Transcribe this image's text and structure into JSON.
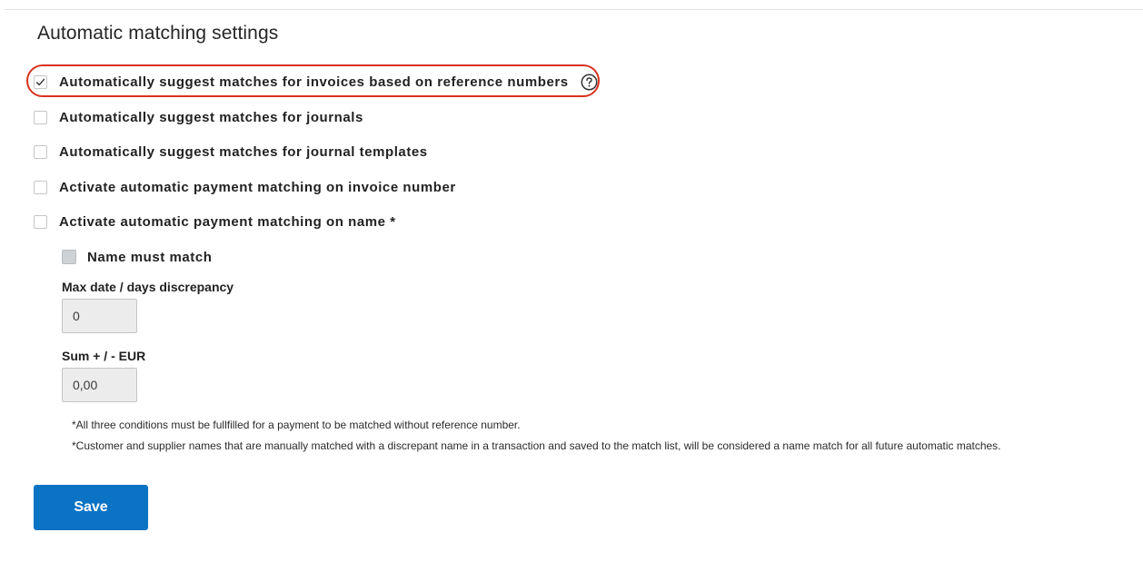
{
  "section": {
    "title": "Automatic matching settings"
  },
  "options": [
    {
      "label": "Automatically suggest matches for invoices based on reference numbers",
      "checked": true
    },
    {
      "label": "Automatically suggest matches for journals",
      "checked": false
    },
    {
      "label": "Automatically suggest matches for journal templates",
      "checked": false
    },
    {
      "label": "Activate automatic payment matching on invoice number",
      "checked": false
    },
    {
      "label": "Activate automatic payment matching on name *",
      "checked": false
    }
  ],
  "name_match": {
    "label": "Name must match",
    "checked": false,
    "disabled": true
  },
  "max_days": {
    "label": "Max date / days discrepancy",
    "value": "0"
  },
  "sum_tolerance": {
    "label": "Sum + / - EUR",
    "value": "0,00"
  },
  "footnotes": [
    "*All three conditions must be fullfilled for a payment to be matched without reference number.",
    "*Customer and supplier names that are manually matched with a discrepant name in a transaction and saved to the match list, will be considered a name match for all future automatic matches."
  ],
  "save_button": {
    "label": "Save"
  },
  "icons": {
    "help": "question-circle-icon",
    "check": "checkmark-icon"
  },
  "colors": {
    "accent": "#0a73c4",
    "highlight": "#d9321f"
  }
}
